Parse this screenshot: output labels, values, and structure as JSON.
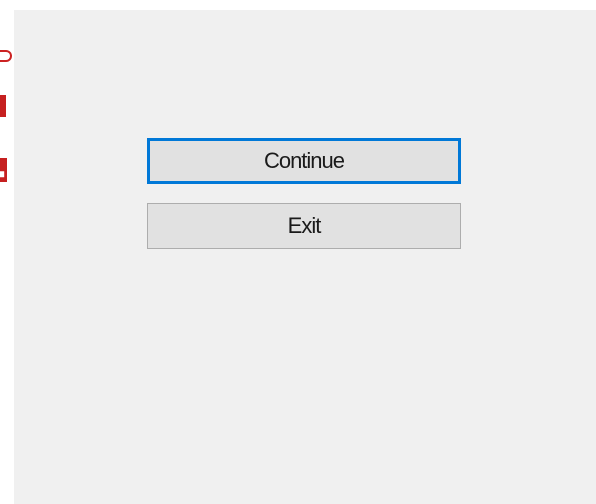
{
  "dialog": {
    "buttons": {
      "continue_label": "Continue",
      "exit_label": "Exit"
    },
    "accent_color": "#0078d7",
    "panel_color": "#f0f0f0",
    "edge_mark_color": "#cc2222"
  }
}
